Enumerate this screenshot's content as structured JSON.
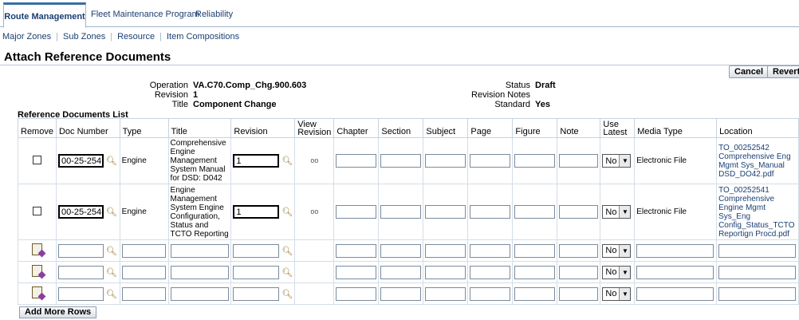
{
  "tabs": [
    "Route Management",
    "Fleet Maintenance Program",
    "Reliability"
  ],
  "subnav": [
    "Major Zones",
    "Sub Zones",
    "Resource",
    "Item Compositions"
  ],
  "page_title": "Attach Reference Documents",
  "buttons": {
    "cancel": "Cancel",
    "revert": "Revert",
    "add_more_rows": "Add More Rows"
  },
  "header": {
    "operation_label": "Operation",
    "operation_value": "VA.C70.Comp_Chg.900.603",
    "revision_label": "Revision",
    "revision_value": "1",
    "title_label": "Title",
    "title_value": "Component Change",
    "status_label": "Status",
    "status_value": "Draft",
    "revision_notes_label": "Revision Notes",
    "revision_notes_value": "",
    "standard_label": "Standard",
    "standard_value": "Yes"
  },
  "list_label": "Reference Documents List",
  "columns": [
    "Remove",
    "Doc Number",
    "Type",
    "Title",
    "Revision",
    "View Revision",
    "Chapter",
    "Section",
    "Subject",
    "Page",
    "Figure",
    "Note",
    "Use Latest",
    "Media Type",
    "Location"
  ],
  "rows": [
    {
      "doc_number": "00-25-254",
      "type": "Engine",
      "title": "Comprehensive Engine Management System Manual for DSD: D042",
      "revision": "1",
      "use_latest": "No",
      "media_type": "Electronic File",
      "location": "TO_00252542 Comprehensive Eng Mgmt Sys_Manual DSD_DO42.pdf"
    },
    {
      "doc_number": "00-25-254-",
      "type": "Engine",
      "title": "Engine Management System Engine Configuration, Status and TCTO Reporting",
      "revision": "1",
      "use_latest": "No",
      "media_type": "Electronic File",
      "location": "TO_00252541 Comprehensive Engine Mgmt Sys_Eng Config_Status_TCTO Reportign Procd.pdf"
    }
  ],
  "empty_rows": [
    {
      "use_latest": "No"
    },
    {
      "use_latest": "No"
    },
    {
      "use_latest": "No"
    }
  ],
  "icons": {
    "search": "magnifier-icon",
    "view": "glasses-icon",
    "add": "add-row-icon"
  }
}
